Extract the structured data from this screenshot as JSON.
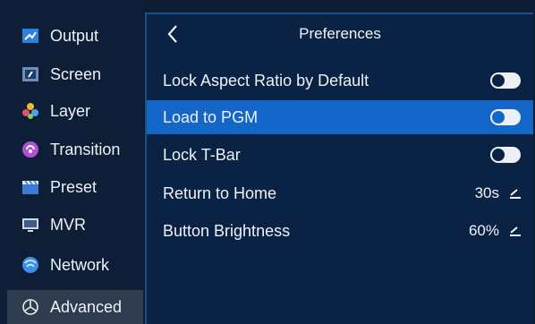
{
  "sidebar": {
    "items": [
      {
        "label": "Output",
        "icon": "output-icon"
      },
      {
        "label": "Screen",
        "icon": "screen-icon"
      },
      {
        "label": "Layer",
        "icon": "layer-icon"
      },
      {
        "label": "Transition",
        "icon": "transition-icon"
      },
      {
        "label": "Preset",
        "icon": "preset-icon"
      },
      {
        "label": "MVR",
        "icon": "mvr-icon"
      },
      {
        "label": "Network",
        "icon": "network-icon"
      },
      {
        "label": "Advanced",
        "icon": "advanced-icon",
        "selected": true
      }
    ]
  },
  "header": {
    "back_icon": "chevron-left-icon",
    "title": "Preferences"
  },
  "settings": [
    {
      "label": "Lock Aspect Ratio by Default",
      "type": "toggle",
      "on": false
    },
    {
      "label": "Load to PGM",
      "type": "toggle",
      "on": false,
      "highlighted": true
    },
    {
      "label": "Lock T-Bar",
      "type": "toggle",
      "on": false
    },
    {
      "label": "Return to Home",
      "type": "value",
      "value": "30s",
      "icon": "edit-icon"
    },
    {
      "label": "Button Brightness",
      "type": "value",
      "value": "60%",
      "icon": "edit-icon"
    }
  ],
  "colors": {
    "background": "#0b1c33",
    "panel": "#0a2244",
    "highlight": "#1466c9",
    "selected_sidebar": "#2f3b4f"
  }
}
